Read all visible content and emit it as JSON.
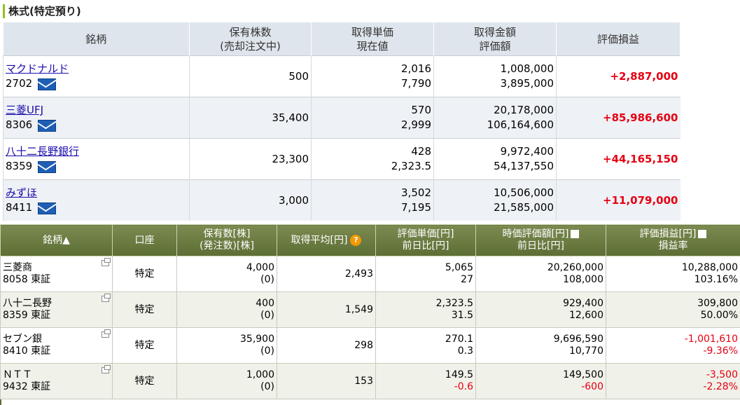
{
  "section": {
    "title": "株式(特定預り)"
  },
  "top_table": {
    "headers": [
      {
        "line1": "銘柄",
        "line2": ""
      },
      {
        "line1": "保有株数",
        "line2": "(売却注文中)"
      },
      {
        "line1": "取得単価",
        "line2": "現在値"
      },
      {
        "line1": "取得金額",
        "line2": "評価額"
      },
      {
        "line1": "評価損益",
        "line2": ""
      }
    ],
    "rows": [
      {
        "name": "マクドナルド",
        "code": "2702",
        "shares": "500",
        "unit_cost": "2,016",
        "price": "7,790",
        "cost_total": "1,008,000",
        "value": "3,895,000",
        "pl": "+2,887,000"
      },
      {
        "name": "三菱UFJ",
        "code": "8306",
        "shares": "35,400",
        "unit_cost": "570",
        "price": "2,999",
        "cost_total": "20,178,000",
        "value": "106,164,600",
        "pl": "+85,986,600"
      },
      {
        "name": "八十二長野銀行",
        "code": "8359",
        "shares": "23,300",
        "unit_cost": "428",
        "price": "2,323.5",
        "cost_total": "9,972,400",
        "value": "54,137,550",
        "pl": "+44,165,150"
      },
      {
        "name": "みずほ",
        "code": "8411",
        "shares": "3,000",
        "unit_cost": "3,502",
        "price": "7,195",
        "cost_total": "10,506,000",
        "value": "21,585,000",
        "pl": "+11,079,000"
      }
    ]
  },
  "bottom_table": {
    "headers": {
      "name": "銘柄▲",
      "account": "口座",
      "qty_line1": "保有数[株]",
      "qty_line2": "(発注数)[株]",
      "avg": "取得平均[円]",
      "eval_unit_line1": "評価単価[円]",
      "eval_unit_line2": "前日比[円]",
      "market_line1": "時価評価額[円]",
      "market_line2": "前日比[円]",
      "pl_line1": "評価損益[円]",
      "pl_line2": "損益率"
    },
    "rows": [
      {
        "name": "三菱商",
        "code_market": "8058 東証",
        "account": "特定",
        "qty": "4,000",
        "order_qty": "(0)",
        "avg": "2,493",
        "eval_unit": "5,065",
        "unit_change": "27",
        "market_value": "20,260,000",
        "value_change": "108,000",
        "pl": "10,288,000",
        "pl_rate": "103.16%"
      },
      {
        "name": "八十二長野",
        "code_market": "8359 東証",
        "account": "特定",
        "qty": "400",
        "order_qty": "(0)",
        "avg": "1,549",
        "eval_unit": "2,323.5",
        "unit_change": "31.5",
        "market_value": "929,400",
        "value_change": "12,600",
        "pl": "309,800",
        "pl_rate": "50.00%"
      },
      {
        "name": "セブン銀",
        "code_market": "8410 東証",
        "account": "特定",
        "qty": "35,900",
        "order_qty": "(0)",
        "avg": "298",
        "eval_unit": "270.1",
        "unit_change": "0.3",
        "market_value": "9,696,590",
        "value_change": "10,770",
        "pl": "-1,001,610",
        "pl_rate": "-9.36%"
      },
      {
        "name": "ＮＴＴ",
        "code_market": "9432 東証",
        "account": "特定",
        "qty": "1,000",
        "order_qty": "(0)",
        "avg": "153",
        "eval_unit": "149.5",
        "unit_change": "-0.6",
        "market_value": "149,500",
        "value_change": "-600",
        "pl": "-3,500",
        "pl_rate": "-2.28%"
      }
    ]
  },
  "colors": {
    "accent_bar": "#8fc31f",
    "gain": "#e60012",
    "loss": "#e60012",
    "top_header_bg": "#dfe5ec",
    "bottom_header_bg": "#6b7c42",
    "link": "#1a0dab"
  },
  "icons": {
    "mail": "mail-icon",
    "help": "help-icon",
    "popup": "popup-window-icon",
    "column_select": "checkbox-icon"
  }
}
